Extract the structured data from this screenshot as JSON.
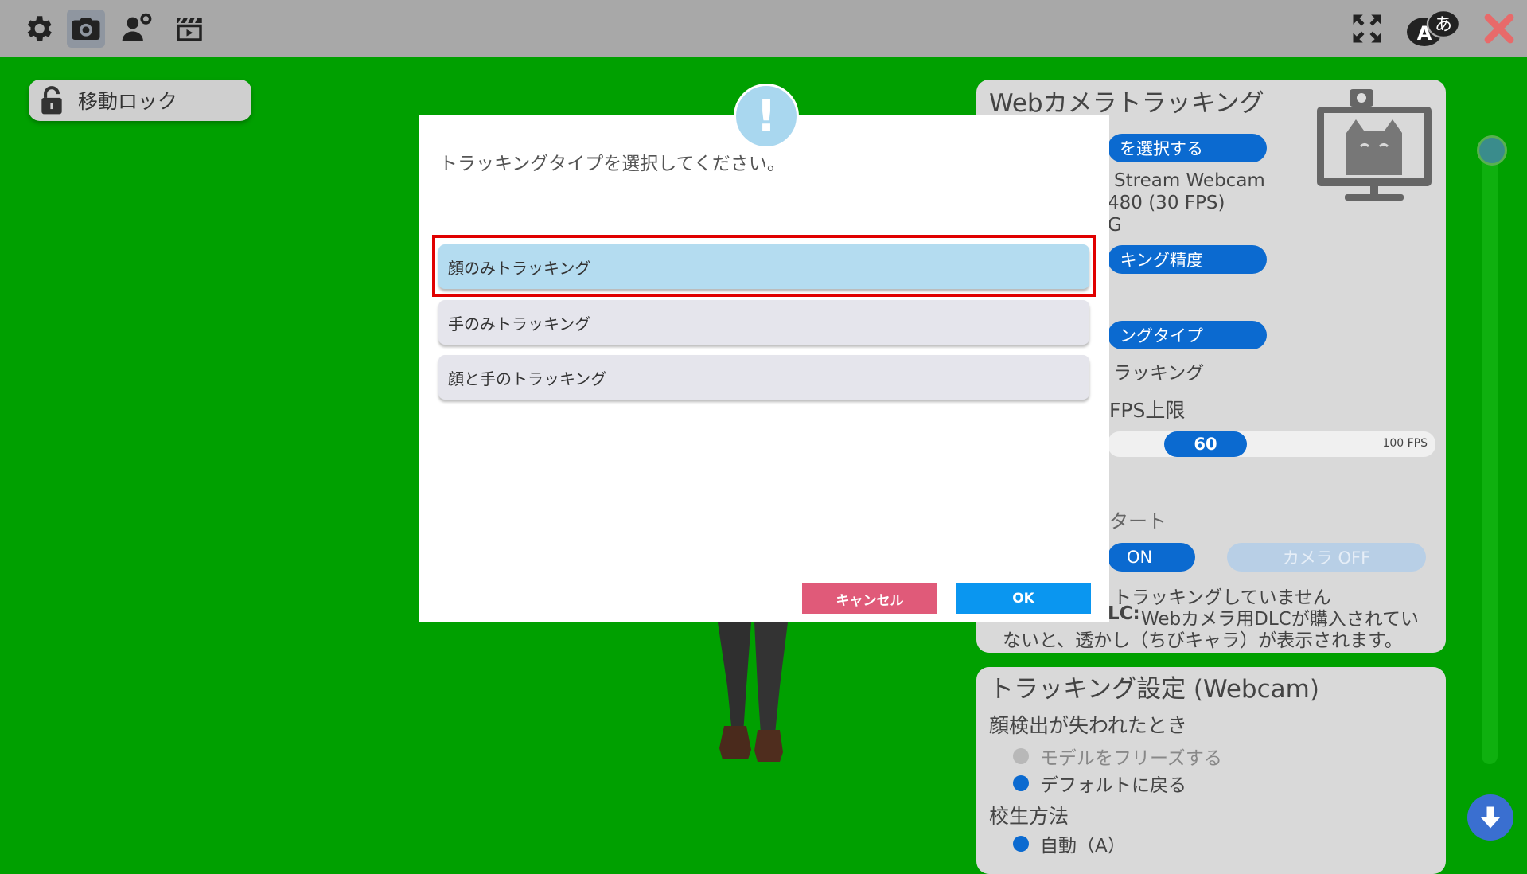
{
  "toolbar": {
    "items": [
      {
        "name": "settings",
        "icon": "gear-icon"
      },
      {
        "name": "camera",
        "icon": "camera-icon",
        "active": true
      },
      {
        "name": "avatar",
        "icon": "user-gear-icon"
      },
      {
        "name": "scene",
        "icon": "clapperboard-icon"
      }
    ],
    "right_items": [
      {
        "name": "fullscreen",
        "icon": "expand-icon"
      },
      {
        "name": "language",
        "icon": "translate-icon",
        "glyph_a": "A",
        "glyph_ja": "あ"
      },
      {
        "name": "close",
        "icon": "close-icon"
      }
    ]
  },
  "lock_button": {
    "label": "移動ロック",
    "icon": "lock-icon"
  },
  "webcam_panel": {
    "title": "Webカメラトラッキング",
    "select_button": "を選択する",
    "device_name": "Stream Webcam",
    "resolution": "480 (30 FPS)",
    "format_tail": "G",
    "precision_button": "キング精度",
    "type_button": "ングタイプ",
    "type_value": "ラッキング",
    "fps_label": "FPS上限",
    "fps_value": "60",
    "fps_max": "100 FPS",
    "start_label": "タート",
    "camera_on": "ON",
    "camera_off": "カメラ OFF",
    "status_text": "トラッキングしていません",
    "dlc_label": "LC:",
    "dlc_text": "Webカメラ用DLCが購入されてい",
    "dlc_text2": "ないと、透かし（ちびキャラ）が表示されます。",
    "cat_icon": "webcam-cat-icon"
  },
  "tracking_settings_panel": {
    "title": "トラッキング設定 (Webcam)",
    "face_lost_label": "顔検出が失われたとき",
    "option_freeze": "モデルをフリーズする",
    "option_default": "デフォルトに戻る",
    "calibration_label": "校生方法",
    "calibration_auto": "自動（A）"
  },
  "dialog": {
    "message": "トラッキングタイプを選択してください。",
    "options": [
      {
        "label": "顔のみトラッキング",
        "selected": true
      },
      {
        "label": "手のみトラッキング",
        "selected": false
      },
      {
        "label": "顔と手のトラッキング",
        "selected": false
      }
    ],
    "cancel_label": "キャンセル",
    "ok_label": "OK",
    "alert_icon": "exclamation-icon",
    "alert_glyph": "!"
  },
  "colors": {
    "background": "#00a000",
    "toolbar": "#a8a8a8",
    "selected_option": "#b4dcf0",
    "highlight": "#e00000",
    "cancel": "#e05a79",
    "ok": "#0a96f0",
    "pill": "#0b6ad0"
  }
}
